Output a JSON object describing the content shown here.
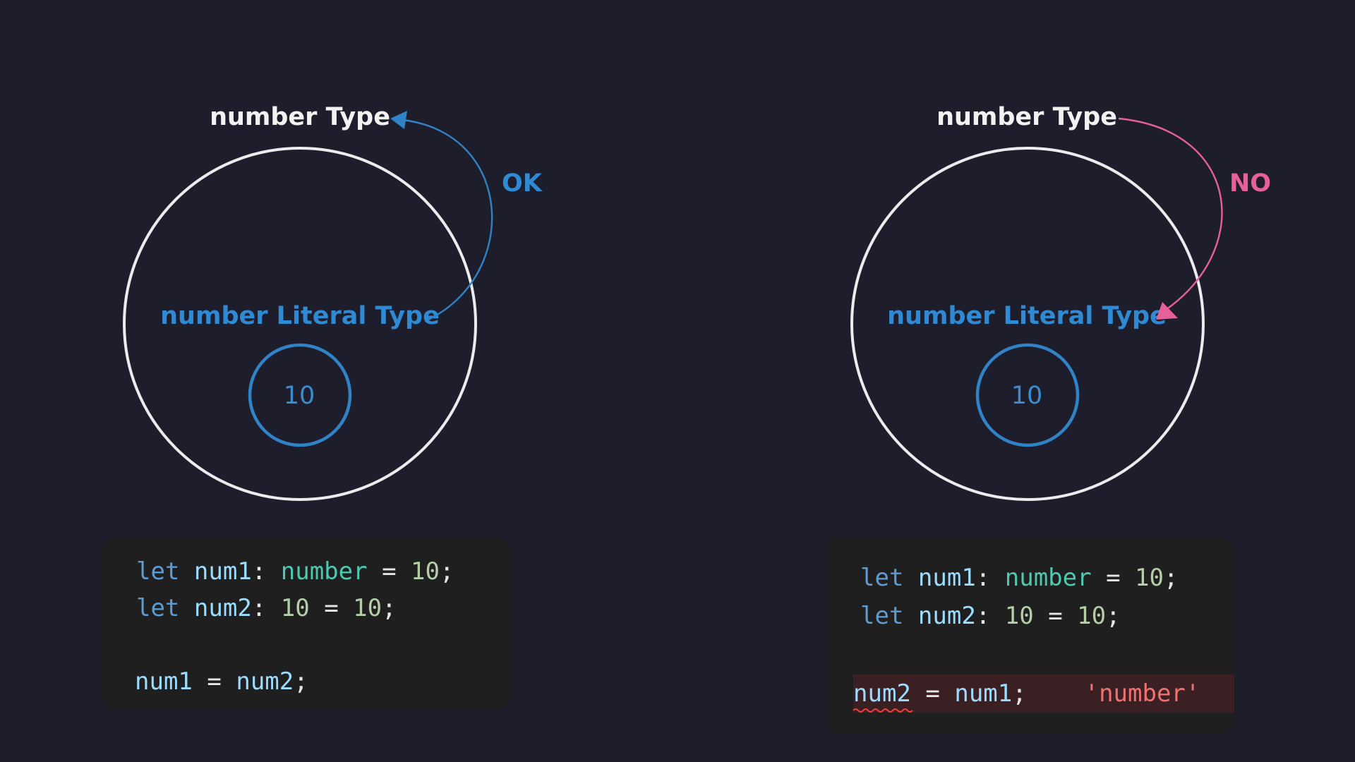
{
  "left": {
    "outer_label": "number Type",
    "literal_label": "number Literal Type",
    "value_label": "10",
    "arrow_label": "OK",
    "code": [
      {
        "kw": "let",
        "name": "num1",
        "sep": ":",
        "type": "number",
        "eq": "=",
        "value": "10",
        "end": ";"
      },
      {
        "kw": "let",
        "name": "num2",
        "sep": ":",
        "type": "10",
        "eq": "=",
        "value": "10",
        "end": ";"
      }
    ],
    "assignment": {
      "lhs": "num1",
      "eq": "=",
      "rhs": "num2",
      "end": ";"
    }
  },
  "right": {
    "outer_label": "number Type",
    "literal_label": "number Literal Type",
    "value_label": "10",
    "arrow_label": "NO",
    "code": [
      {
        "kw": "let",
        "name": "num1",
        "sep": ":",
        "type": "number",
        "eq": "=",
        "value": "10",
        "end": ";"
      },
      {
        "kw": "let",
        "name": "num2",
        "sep": ":",
        "type": "10",
        "eq": "=",
        "value": "10",
        "end": ";"
      }
    ],
    "assignment": {
      "lhs": "num2",
      "eq": "=",
      "rhs": "num1",
      "end": ";",
      "error_hint": "'number'"
    }
  },
  "colors": {
    "background": "#1d1d2b",
    "outer_circle": "#ececec",
    "literal": "#2f8ad3",
    "ok_arrow": "#2f83c6",
    "no_arrow": "#e8609a",
    "keyword": "#5d9bd1",
    "variable": "#9cdcfe",
    "type": "#4ec9b0",
    "number": "#b5cea8",
    "error": "#f0716f"
  }
}
